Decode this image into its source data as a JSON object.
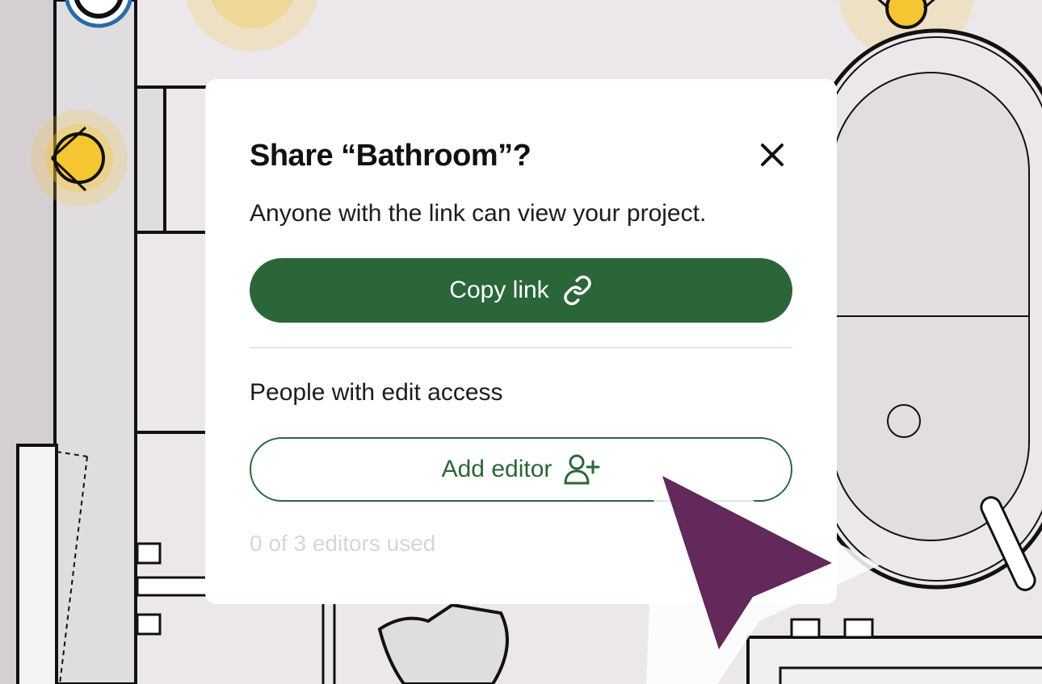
{
  "dialog": {
    "title": "Share “Bathroom”?",
    "description": "Anyone with the link can view your project.",
    "copy_link_label": "Copy link",
    "section_label": "People with edit access",
    "add_editor_label": "Add editor",
    "usage_text": "0 of 3 editors used",
    "icons": {
      "close": "close-icon",
      "copy": "link-icon",
      "add": "user-plus-icon"
    }
  },
  "colors": {
    "accent": "#2b663a",
    "cursor": "#62295a",
    "light_glow": "#f5c632",
    "background": "#ece7ea"
  }
}
